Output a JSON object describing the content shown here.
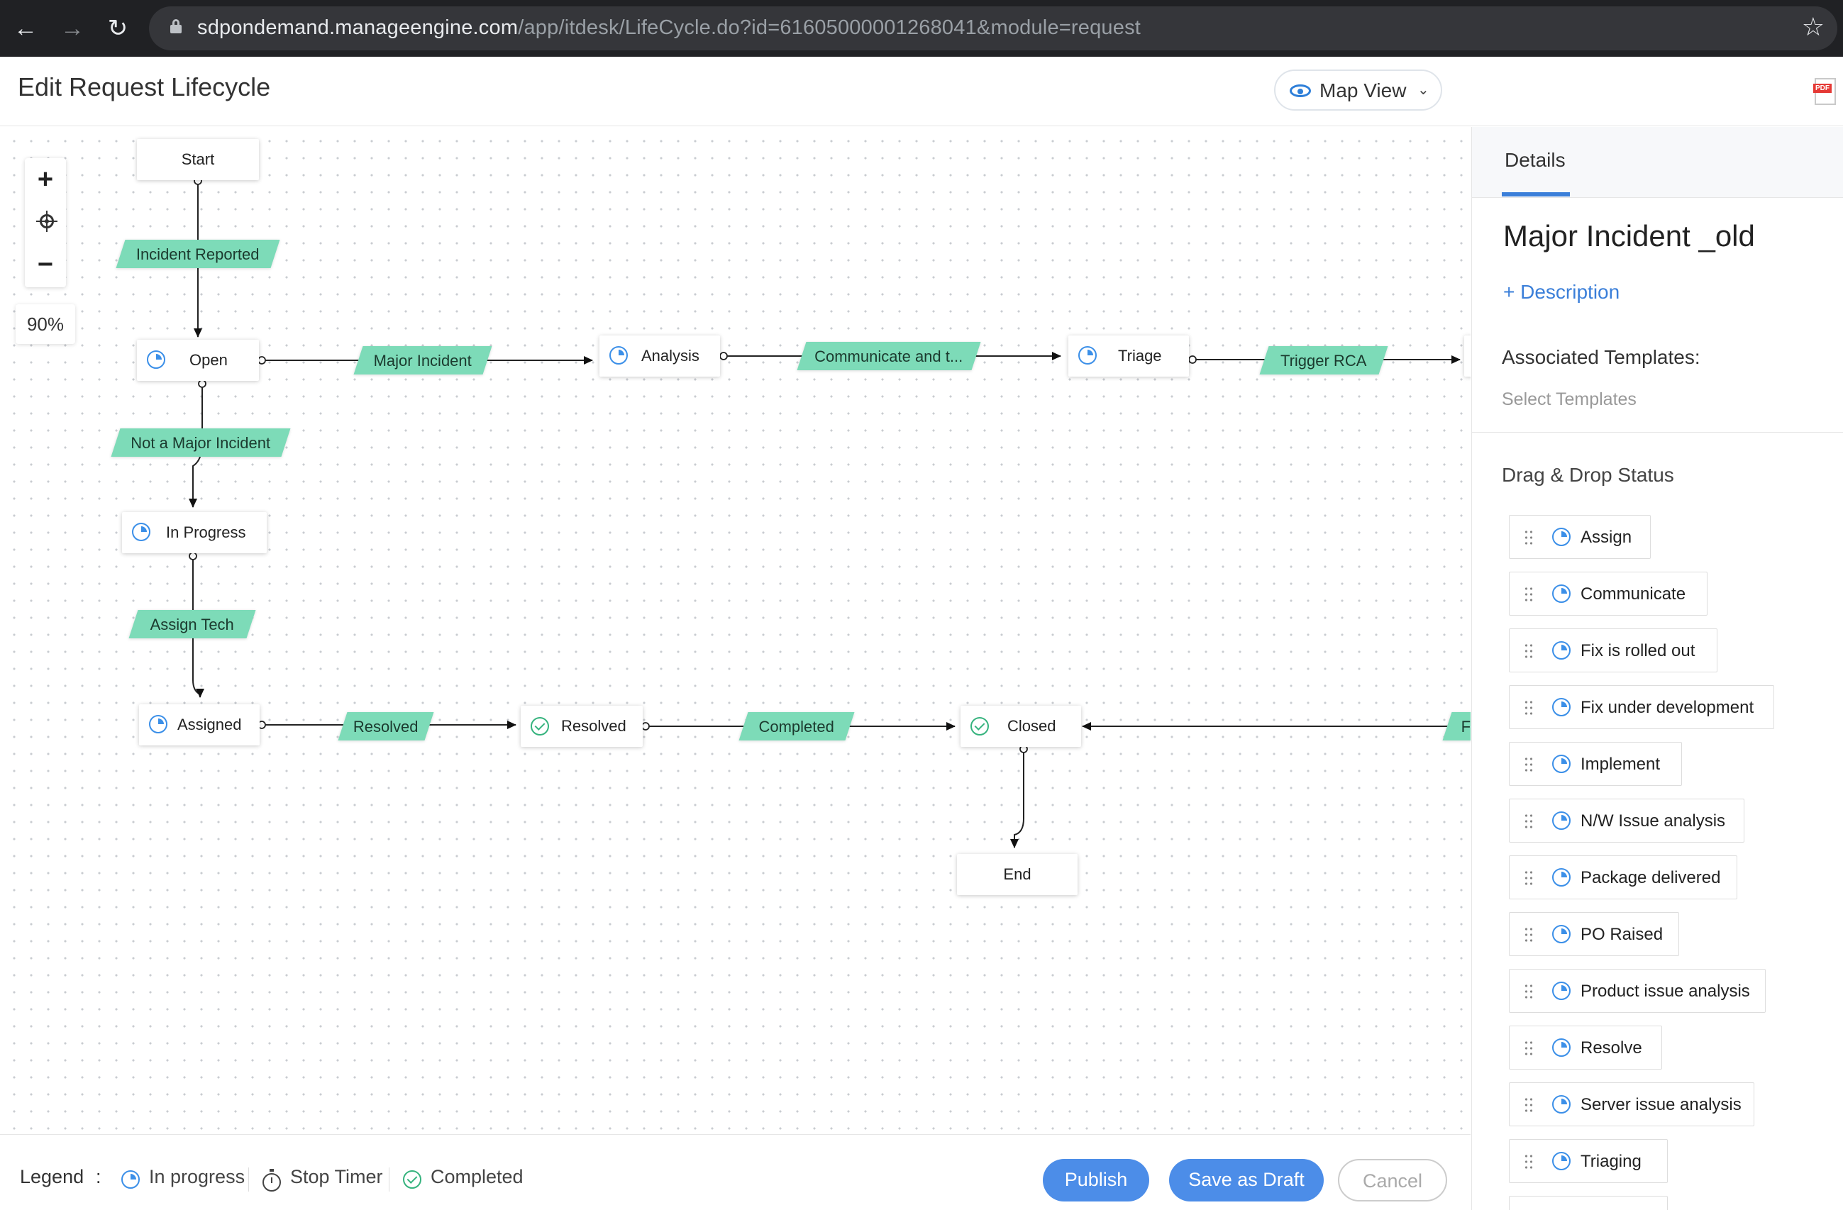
{
  "browser": {
    "url_host": "sdpondemand.manageengine.com",
    "url_path": "/app/itdesk/LifeCycle.do?id=61605000001268041&module=request",
    "back_icon": "arrow-left-icon",
    "forward_icon": "arrow-right-icon",
    "reload_icon": "reload-icon",
    "bookmark_icon": "star-icon"
  },
  "header": {
    "title": "Edit Request Lifecycle",
    "view_selector": "Map View",
    "pdf_tag": "PDF"
  },
  "canvas": {
    "zoom_in": "+",
    "zoom_out": "−",
    "zoom_level": "90%",
    "nodes": {
      "start": "Start",
      "open": "Open",
      "analysis": "Analysis",
      "triage": "Triage",
      "in_progress": "In Progress",
      "assigned": "Assigned",
      "resolved": "Resolved",
      "closed": "Closed",
      "end": "End"
    },
    "transitions": {
      "incident_reported": "Incident Reported",
      "major_incident": "Major Incident",
      "communicate": "Communicate and t...",
      "trigger_rca": "Trigger RCA",
      "not_major": "Not a Major Incident",
      "assign_tech": "Assign Tech",
      "resolved": "Resolved",
      "completed": "Completed",
      "partial_right": "F"
    }
  },
  "footer": {
    "legend_title": "Legend",
    "legend_colon": ":",
    "legend_in_progress": "In progress",
    "legend_stop_timer": "Stop Timer",
    "legend_completed": "Completed",
    "publish": "Publish",
    "save_draft": "Save as Draft",
    "cancel": "Cancel"
  },
  "panel": {
    "tab": "Details",
    "lifecycle_name": "Major Incident _old",
    "add_description": "+ Description",
    "associated_templates_label": "Associated Templates:",
    "select_templates": "Select Templates",
    "drag_drop_label": "Drag & Drop Status",
    "statuses": [
      "Assign",
      "Communicate",
      "Fix is rolled out",
      "Fix under development",
      "Implement",
      "N/W Issue analysis",
      "Package delivered",
      "PO Raised",
      "Product issue analysis",
      "Resolve",
      "Server issue analysis",
      "Triaging"
    ]
  },
  "colors": {
    "accent": "#4c8de8",
    "transition_label": "#7ddbb8",
    "in_progress": "#3b8fe8",
    "completed": "#36b37e"
  }
}
